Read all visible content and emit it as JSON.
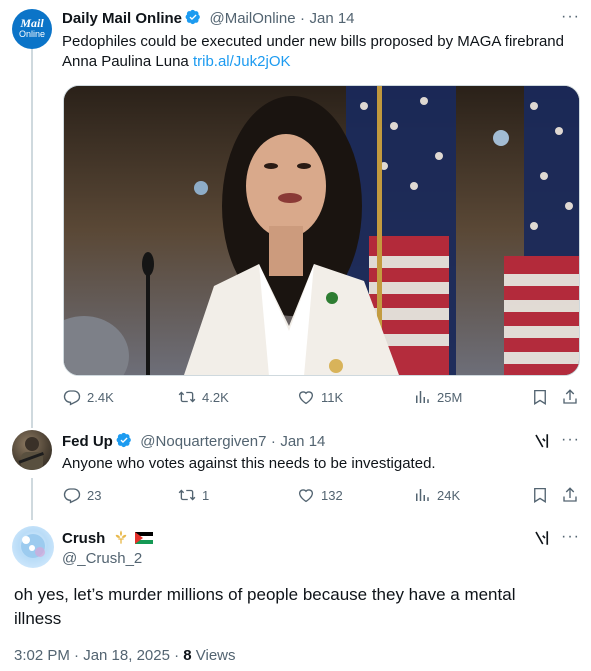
{
  "tweet1": {
    "avatar_text_top": "Mail",
    "avatar_text_bottom": "Online",
    "name": "Daily Mail Online",
    "handle": "@MailOnline",
    "sep": "·",
    "date": "Jan 14",
    "text_line1": "Pedophiles could be executed under new bills proposed by MAGA firebrand",
    "text_line2": "Anna Paulina Luna",
    "link": "trib.al/Juk2jOK",
    "replies": "2.4K",
    "retweets": "4.2K",
    "likes": "11K",
    "views": "25M"
  },
  "tweet2": {
    "name": "Fed Up",
    "handle": "@Noquartergiven7",
    "sep": "·",
    "date": "Jan 14",
    "text": "Anyone who votes against this needs to be investigated.",
    "replies": "23",
    "retweets": "1",
    "likes": "132",
    "views": "24K"
  },
  "tweet3": {
    "name": "Crush",
    "handle": "@_Crush_2",
    "text_line1": "oh yes, let’s murder millions of people because they have a mental",
    "text_line2": "illness",
    "time": "3:02 PM · Jan 18, 2025 · ",
    "views_count": "8",
    "views_label": " Views"
  },
  "icons": {
    "more": "more-dots-icon",
    "grok": "grok-icon",
    "reply": "reply-icon",
    "retweet": "retweet-icon",
    "like": "heart-icon",
    "views": "views-chart-icon",
    "bookmark": "bookmark-icon",
    "share": "share-icon"
  },
  "colors": {
    "verified": "#1d9bf0",
    "link": "#1d9bf0",
    "muted": "#536471",
    "thread_line": "#cfd9de",
    "mail_badge": "#0b74c8"
  }
}
